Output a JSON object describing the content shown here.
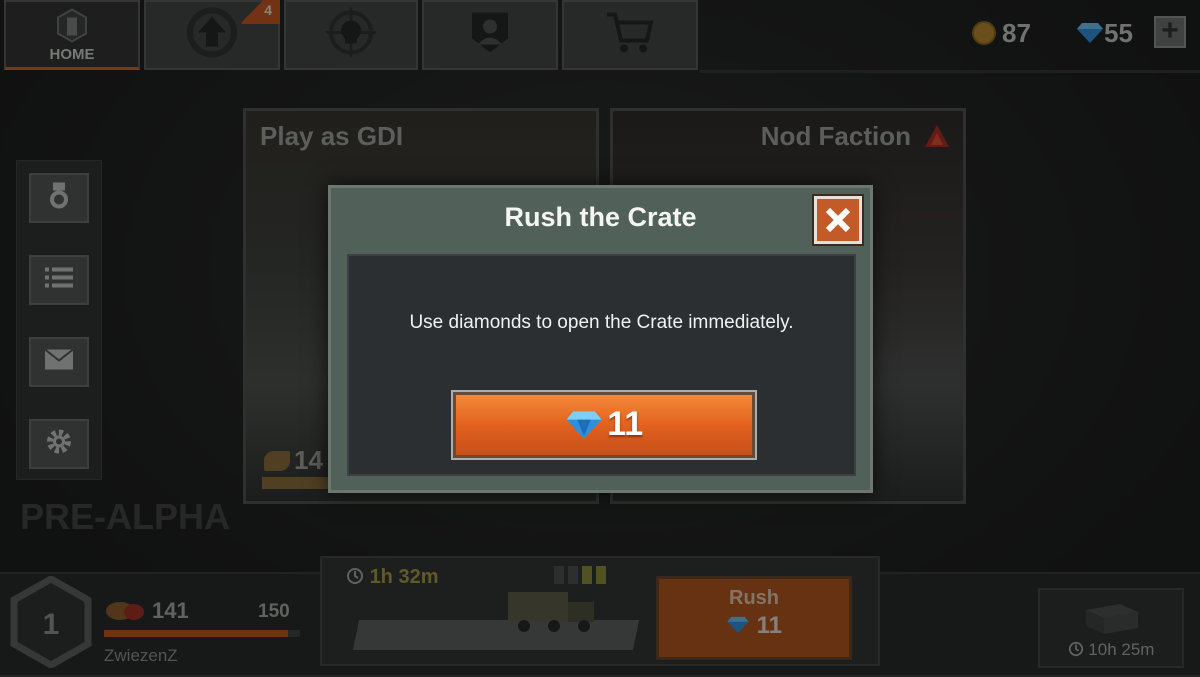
{
  "topbar": {
    "home_label": "HOME",
    "upgrade_badge": "4",
    "coins": "87",
    "diamonds": "55",
    "plus_label": "+"
  },
  "sidebar": {
    "prealpha_label": "PRE-ALPHA"
  },
  "cards": {
    "gdi_title": "Play as GDI",
    "gdi_level_partial": "14",
    "nod_title": "Nod Faction"
  },
  "modal": {
    "title": "Rush the Crate",
    "message": "Use diamonds to open the Crate immediately.",
    "cost": "11"
  },
  "bottombar": {
    "rank": "1",
    "xp_value": "141",
    "xp_max": "150",
    "xp_progress": 0.94,
    "player_name": "ZwiezenZ",
    "crate_timer": "1h 32m",
    "rush_label": "Rush",
    "rush_cost": "11",
    "next_crate_timer": "10h 25m"
  },
  "colors": {
    "accent_orange": "#e2611e",
    "diamond_blue": "#3aa0e8",
    "coin_gold": "#b8862a"
  }
}
